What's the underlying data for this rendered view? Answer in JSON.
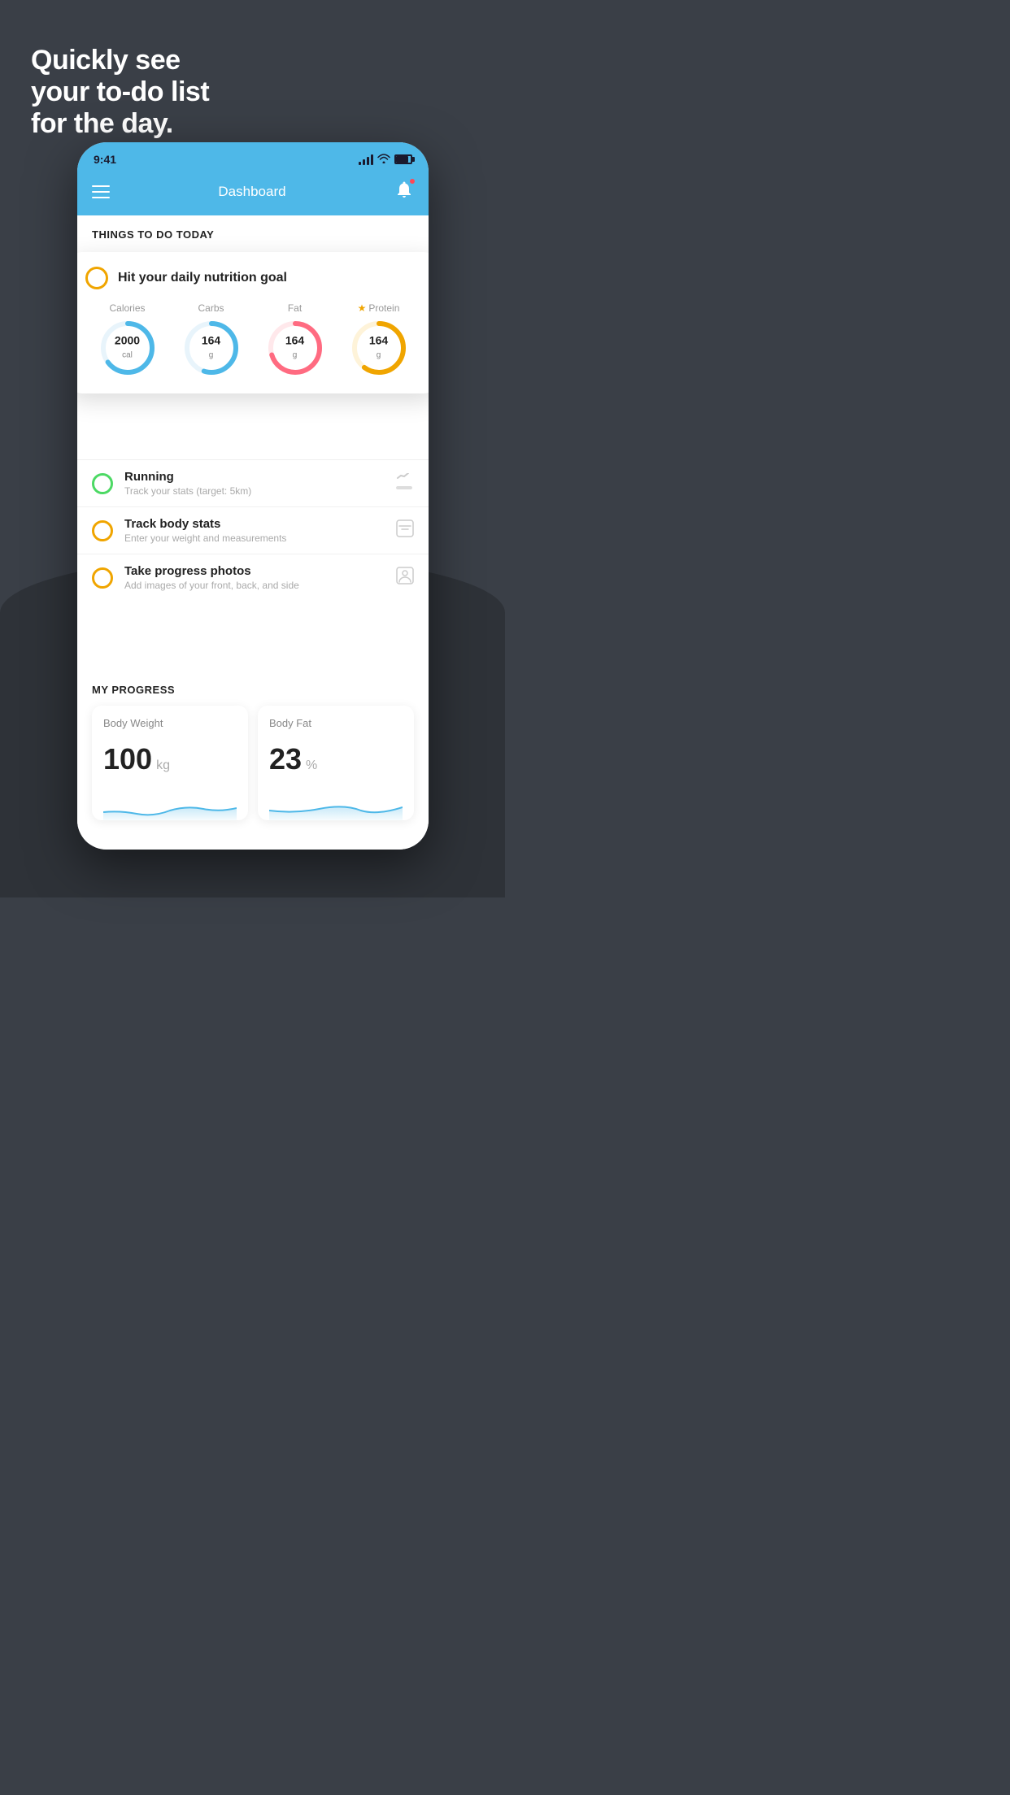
{
  "background": {
    "color": "#3a3f47"
  },
  "headline": {
    "line1": "Quickly see",
    "line2": "your to-do list",
    "line3": "for the day."
  },
  "phone": {
    "statusBar": {
      "time": "9:41"
    },
    "header": {
      "title": "Dashboard"
    },
    "sections": {
      "today": {
        "label": "THINGS TO DO TODAY"
      },
      "progress": {
        "label": "MY PROGRESS"
      }
    },
    "nutritionCard": {
      "checkColor": "#f0a500",
      "title": "Hit your daily nutrition goal",
      "items": [
        {
          "label": "Calories",
          "value": "2000",
          "unit": "cal",
          "color": "#4eb8e8",
          "percent": 65,
          "highlighted": false
        },
        {
          "label": "Carbs",
          "value": "164",
          "unit": "g",
          "color": "#4eb8e8",
          "percent": 55,
          "highlighted": false
        },
        {
          "label": "Fat",
          "value": "164",
          "unit": "g",
          "color": "#ff6b81",
          "percent": 70,
          "highlighted": false
        },
        {
          "label": "Protein",
          "value": "164",
          "unit": "g",
          "color": "#f0a500",
          "percent": 60,
          "highlighted": true
        }
      ]
    },
    "todoItems": [
      {
        "id": "running",
        "title": "Running",
        "subtitle": "Track your stats (target: 5km)",
        "circleColor": "green",
        "icon": "👟"
      },
      {
        "id": "body-stats",
        "title": "Track body stats",
        "subtitle": "Enter your weight and measurements",
        "circleColor": "yellow",
        "icon": "⚖"
      },
      {
        "id": "progress-photos",
        "title": "Take progress photos",
        "subtitle": "Add images of your front, back, and side",
        "circleColor": "yellow",
        "icon": "👤"
      }
    ],
    "progressCards": [
      {
        "id": "body-weight",
        "title": "Body Weight",
        "value": "100",
        "unit": "kg"
      },
      {
        "id": "body-fat",
        "title": "Body Fat",
        "value": "23",
        "unit": "%"
      }
    ]
  }
}
